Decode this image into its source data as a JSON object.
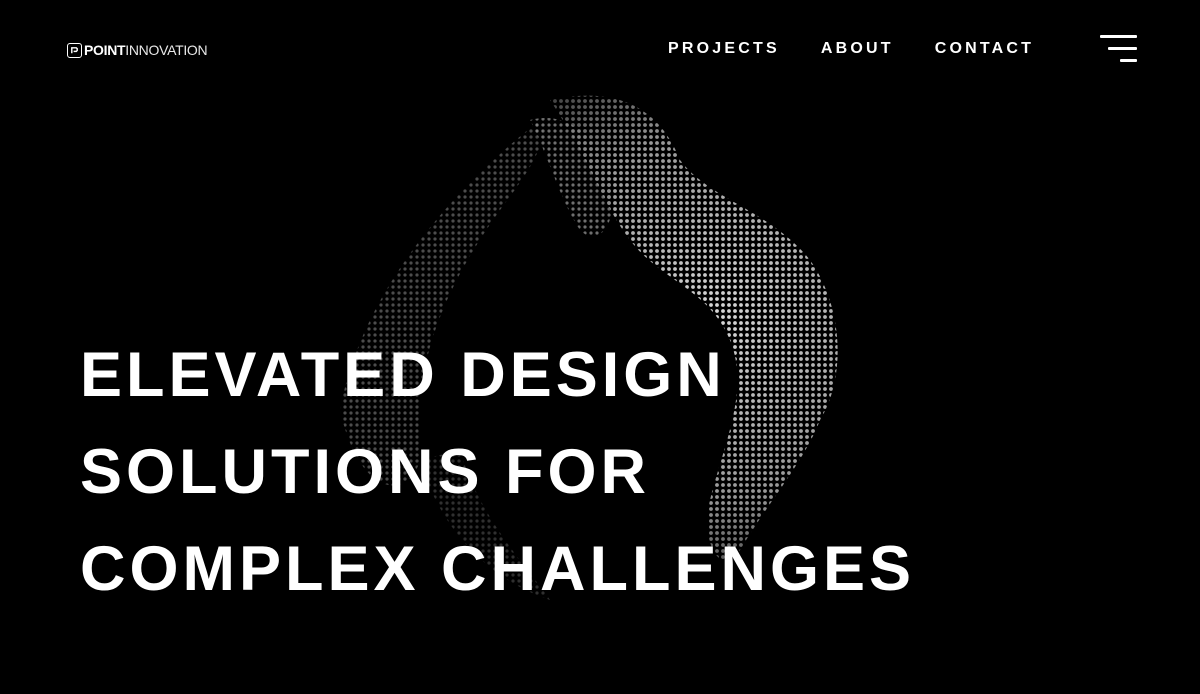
{
  "header": {
    "logo": {
      "bold": "POINT",
      "light": "INNOVATION",
      "icon": "logo-mark-icon"
    },
    "nav": [
      {
        "label": "PROJECTS"
      },
      {
        "label": "ABOUT"
      },
      {
        "label": "CONTACT"
      }
    ],
    "menu_icon": "hamburger-menu-icon"
  },
  "hero": {
    "headline_lines": [
      "ELEVATED DESIGN",
      "SOLUTIONS FOR",
      "COMPLEX CHALLENGES"
    ],
    "background_art": "dotted-3d-wave-sculpture"
  },
  "colors": {
    "background": "#000000",
    "text": "#ffffff"
  }
}
